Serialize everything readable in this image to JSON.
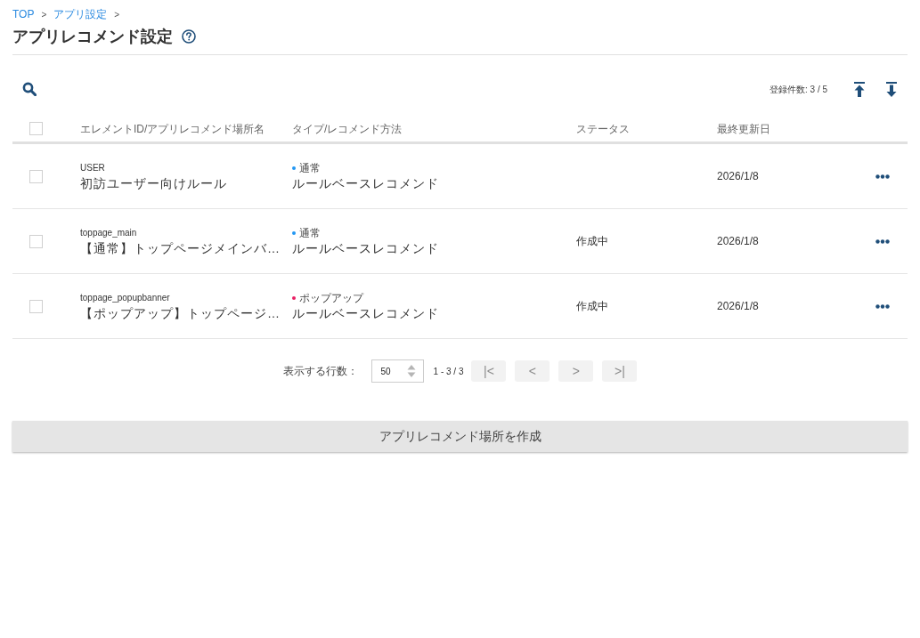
{
  "breadcrumb": [
    {
      "label": "TOP",
      "separator": ">"
    },
    {
      "label": "アプリ設定",
      "separator": ">"
    }
  ],
  "page_title": "アプリレコメンド設定",
  "toolbar": {
    "count_label": "登録件数: 3 / 5"
  },
  "table": {
    "header_checkbox": {
      "checked": false
    },
    "columns": [
      "エレメントID/アプリレコメンド場所名",
      "タイプ/レコメンド方法",
      "ステータス",
      "最終更新日"
    ],
    "rows": [
      {
        "checked": false,
        "element_id": "USER",
        "name": "初訪ユーザー向けルール",
        "type": {
          "label": "通常",
          "color": "#2196f3"
        },
        "method": "ルールベースレコメンド",
        "date": "2026/1/8"
      },
      {
        "checked": false,
        "element_id": "toppage_main",
        "name": "【通常】トップページメインバ…",
        "type": {
          "label": "通常",
          "color": "#2196f3"
        },
        "method": "ルールベースレコメンド",
        "status": "作成中",
        "date": "2026/1/8"
      },
      {
        "checked": false,
        "element_id": "toppage_popupbanner",
        "name": "【ポップアップ】トップページ…",
        "type": {
          "label": "ポップアップ",
          "color": "#e91e63"
        },
        "method": "ルールベースレコメンド",
        "status": "作成中",
        "date": "2026/1/8"
      }
    ]
  },
  "pagination": {
    "rows_label": "表示する行数：",
    "rows_per_page": "50",
    "range": "1 - 3 / 3",
    "buttons": [
      {
        "label": "|<",
        "disabled": true
      },
      {
        "label": "<",
        "disabled": true
      },
      {
        "label": ">",
        "disabled": true
      },
      {
        "label": ">|",
        "disabled": true
      }
    ]
  },
  "create_button": "アプリレコメンド場所を作成"
}
